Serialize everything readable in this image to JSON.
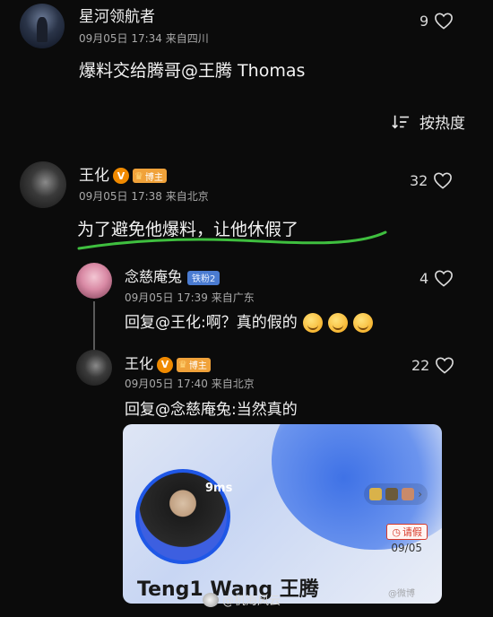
{
  "comment1": {
    "name": "星河领航者",
    "time": "09月05日 17:34",
    "location": "来自四川",
    "likes": "9",
    "text": "爆料交给腾哥@王腾 Thomas"
  },
  "sort": {
    "label": "按热度",
    "icon": "sort-icon"
  },
  "comment2": {
    "name": "王化",
    "verified": "V",
    "badge": "博主",
    "time": "09月05日 17:38",
    "location": "来自北京",
    "likes": "32",
    "text": "为了避免他爆料，让他休假了",
    "highlight_color": "#3fbf3f"
  },
  "reply1": {
    "name": "念慈庵兔",
    "badge": "铁粉2",
    "time": "09月05日 17:39",
    "location": "来自广东",
    "likes": "4",
    "text": "回复@王化:啊？真的假的"
  },
  "reply2": {
    "name": "王化",
    "verified": "V",
    "badge": "博主",
    "time": "09月05日 17:40",
    "location": "来自北京",
    "likes": "22",
    "text": "回复@念慈庵兔:当然真的",
    "card": {
      "corner_text": "9ms",
      "status_tag": "请假",
      "date": "09/05",
      "name": "Teng1 Wang 王腾"
    }
  },
  "watermark": {
    "text": "@机海风云",
    "faint": "@微博"
  },
  "colors": {
    "background": "#0b0b0b",
    "accent_orange": "#f08a00",
    "card_blue": "#1f57e6"
  }
}
